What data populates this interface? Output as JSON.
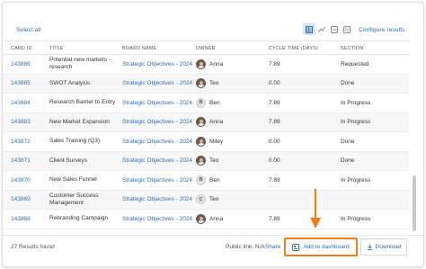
{
  "toolbar": {
    "select_all": "Select all",
    "configure": "Configure results",
    "view_icons": [
      "table-view-icon",
      "chart-view-icon",
      "timeline-view-icon",
      "list-view-icon"
    ]
  },
  "table": {
    "columns": [
      "CARD ID",
      "TITLE",
      "BOARD NAME",
      "OWNER",
      "CYCLE TIME (DAYS)",
      "SECTION"
    ],
    "rows": [
      {
        "id": "143886",
        "title": "Potential new markets - research",
        "board": "Strategic Objectives - 2024",
        "owner": "Anna",
        "owner_avatar": "photo",
        "cycle": "7.89",
        "section": "Requested"
      },
      {
        "id": "143885",
        "title": "SWOT Analysis",
        "board": "Strategic Objectives - 2024",
        "owner": "Teo",
        "owner_avatar": "photo",
        "cycle": "0.00",
        "section": "Done"
      },
      {
        "id": "143884",
        "title": "Research Barrier to Entry",
        "board": "Strategic Objectives - 2024",
        "owner": "Ben",
        "owner_avatar": "B",
        "cycle": "7.89",
        "section": "In Progress"
      },
      {
        "id": "143883",
        "title": "New Market Expansion",
        "board": "Strategic Objectives - 2024",
        "owner": "Anna",
        "owner_avatar": "photo",
        "cycle": "7.89",
        "section": "In Progress"
      },
      {
        "id": "143872",
        "title": "Sales Training (Q3)",
        "board": "Strategic Objectives - 2024",
        "owner": "Miley",
        "owner_avatar": "photo",
        "cycle": "0.00",
        "section": "Done"
      },
      {
        "id": "143871",
        "title": "Client Surveys",
        "board": "Strategic Objectives - 2024",
        "owner": "Teo",
        "owner_avatar": "photo",
        "cycle": "0.00",
        "section": "Done"
      },
      {
        "id": "143870",
        "title": "New Sales Funnel",
        "board": "Strategic Objectives - 2024",
        "owner": "Ben",
        "owner_avatar": "B",
        "cycle": "7.89",
        "section": "In Progress"
      },
      {
        "id": "143869",
        "title": "Customer Success Management",
        "board": "Strategic Objectives - 2024",
        "owner": "Teo",
        "owner_avatar": "C",
        "cycle": "",
        "section": ""
      },
      {
        "id": "143868",
        "title": "Rebranding Campaign",
        "board": "Strategic Objectives - 2024",
        "owner": "Anna",
        "owner_avatar": "photo",
        "cycle": "7.89",
        "section": "In Progress"
      }
    ]
  },
  "footer": {
    "results": "27 Results found",
    "public_link": "Public link: N/A",
    "share": "Share",
    "add_to_dashboard": "Add to dashboard",
    "download": "Download"
  },
  "colors": {
    "link": "#2f6fb0",
    "highlight": "#ee7d1b"
  }
}
